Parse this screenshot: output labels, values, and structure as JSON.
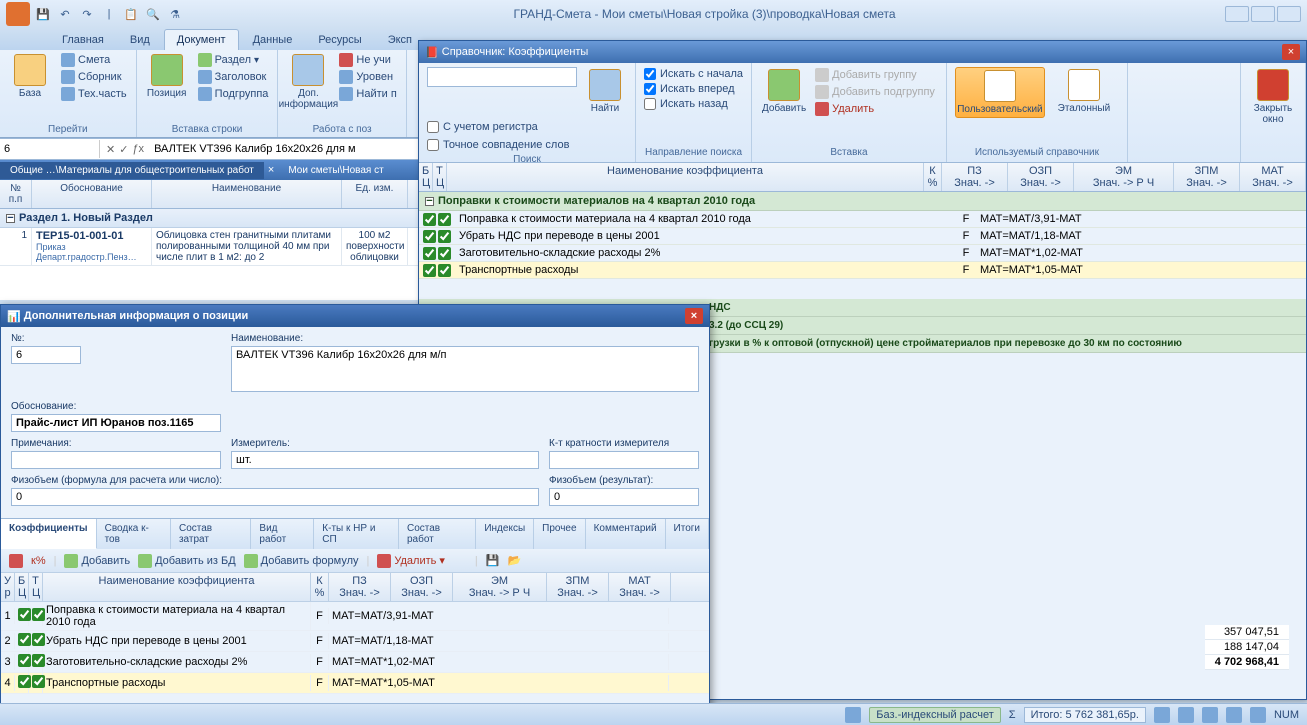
{
  "app": {
    "title": "ГРАНД-Смета - Мои сметы\\Новая стройка (3)\\проводка\\Новая смета"
  },
  "ribbon_tabs": [
    "Главная",
    "Вид",
    "Документ",
    "Данные",
    "Ресурсы",
    "Эксп"
  ],
  "ribbon_tabs_active": 2,
  "ribbon": {
    "g1": {
      "big": "База",
      "items": [
        "Смета",
        "Сборник",
        "Тех.часть"
      ],
      "label": "Перейти"
    },
    "g2": {
      "big": "Позиция",
      "items": [
        "Раздел",
        "Заголовок",
        "Подгруппа"
      ],
      "label": "Вставка строки"
    },
    "g3": {
      "big": "Доп.\nинформация",
      "items": [
        "Не учи",
        "Уровен",
        "Найти п"
      ],
      "label": "Работа с поз"
    }
  },
  "formula": {
    "ref": "6",
    "text": "ВАЛТЕК VT396 Калибр 16х20х26 для м"
  },
  "doc_tabs": {
    "t1": "Общие …\\Материалы для общестроительных работ",
    "t2": "Мои сметы\\Новая ст"
  },
  "grid": {
    "headers": [
      "№\nп.п",
      "Обоснование",
      "Наименование",
      "Ед. изм."
    ],
    "section": "Раздел 1. Новый Раздел",
    "row": {
      "n": "1",
      "code": "ТЕР15-01-001-01",
      "sub": "Приказ\nДепарт.градостр.Пенз…",
      "name": "Облицовка стен гранитными плитами полированными толщиной 40 мм при числе плит в 1 м2: до 2",
      "unit": "100 м2\nповерхности\nоблицовки"
    }
  },
  "ref": {
    "title": "Справочник: Коэффициенты",
    "search": {
      "btn": "Найти",
      "chk1": "С учетом регистра",
      "chk2": "Точное совпадение слов",
      "label": "Поиск"
    },
    "dir": {
      "c1": "Искать с начала",
      "c2": "Искать вперед",
      "c3": "Искать назад",
      "label": "Направление поиска"
    },
    "insert": {
      "big": "Добавить",
      "i1": "Добавить группу",
      "i2": "Добавить подгруппу",
      "i3": "Удалить",
      "label": "Вставка"
    },
    "handbook": {
      "b1": "Пользовательский",
      "b2": "Эталонный",
      "label": "Используемый справочник"
    },
    "close": {
      "btn": "Закрыть\nокно"
    },
    "hdr": {
      "bc": "Б\nЦ",
      "tc": "Т\nЦ",
      "name": "Наименование коэффициента",
      "k": "К\n%",
      "pz": "ПЗ",
      "ozp": "ОЗП",
      "em": "ЭМ",
      "zpm": "ЗПМ",
      "mat": "МАТ",
      "sub": "Знач.    ->"
    },
    "section1": "Поправки к стоимости материалов на 4 квартал 2010 года",
    "rows": [
      {
        "name": "Поправка к стоимости материала на 4 квартал 2010 года",
        "k": "F",
        "formula": "МАТ=МАТ/3,91-МАТ"
      },
      {
        "name": "Убрать НДС при переводе в цены 2001",
        "k": "F",
        "formula": "МАТ=МАТ/1,18-МАТ"
      },
      {
        "name": "Заготовительно-складские расходы 2%",
        "k": "F",
        "formula": "МАТ=МАТ*1,02-МАТ"
      },
      {
        "name": "Транспортные расходы",
        "k": "F",
        "formula": "МАТ=МАТ*1,05-МАТ"
      }
    ],
    "nds_frag": "НДС",
    "sec2_frag1": "3.2 (до ССЦ 29)",
    "sec2_frag2": "грузки в % к оптовой (отпускной) цене стройматериалов при перевозке до 30 км по состоянию"
  },
  "pos": {
    "title": "Дополнительная информация о позиции",
    "labels": {
      "no": "№:",
      "name": "Наименование:",
      "basis": "Обоснование:",
      "notes": "Примечания:",
      "unit": "Измеритель:",
      "mult": "К-т кратности измерителя",
      "fvol_f": "Физобъем (формула для расчета или число):",
      "fvol_r": "Физобъем (результат):"
    },
    "vals": {
      "no": "6",
      "name": "ВАЛТЕК VT396 Калибр 16х20х26 для м/п",
      "basis": "Прайс-лист ИП Юранов поз.1165",
      "unit": "шт.",
      "fvol_f": "0",
      "fvol_r": "0"
    },
    "tabs": [
      "Коэффициенты",
      "Сводка к-тов",
      "Состав затрат",
      "Вид работ",
      "К-ты к НР и СП",
      "Состав работ",
      "Индексы",
      "Прочее",
      "Комментарий",
      "Итоги"
    ],
    "toolbar": {
      "add": "Добавить",
      "addDb": "Добавить из БД",
      "addF": "Добавить формулу",
      "del": "Удалить"
    },
    "ghdr": {
      "u": "У\nр",
      "bc": "Б\nЦ",
      "tc": "Т\nЦ",
      "name": "Наименование коэффициента",
      "k": "К\n%",
      "pz": "ПЗ",
      "ozp": "ОЗП",
      "em": "ЭМ",
      "zpm": "ЗПМ",
      "mat": "МАТ",
      "sub": "Знач.  ->"
    },
    "rows": [
      {
        "n": "1",
        "name": "Поправка к стоимости материала на 4 квартал 2010 года",
        "k": "F",
        "formula": "МАТ=МАТ/3,91-МАТ"
      },
      {
        "n": "2",
        "name": "Убрать НДС при переводе в цены 2001",
        "k": "F",
        "formula": "МАТ=МАТ/1,18-МАТ"
      },
      {
        "n": "3",
        "name": "Заготовительно-складские расходы 2%",
        "k": "F",
        "formula": "МАТ=МАТ*1,02-МАТ"
      },
      {
        "n": "4",
        "name": "Транспортные расходы",
        "k": "F",
        "formula": "МАТ=МАТ*1,05-МАТ"
      }
    ]
  },
  "totals": {
    "v1": "357 047,51",
    "v2": "188 147,04",
    "v3": "4 702 968,41"
  },
  "status": {
    "mode": "Баз.-индексный расчет",
    "total": "Итого: 5 762 381,65р.",
    "num": "NUM"
  }
}
